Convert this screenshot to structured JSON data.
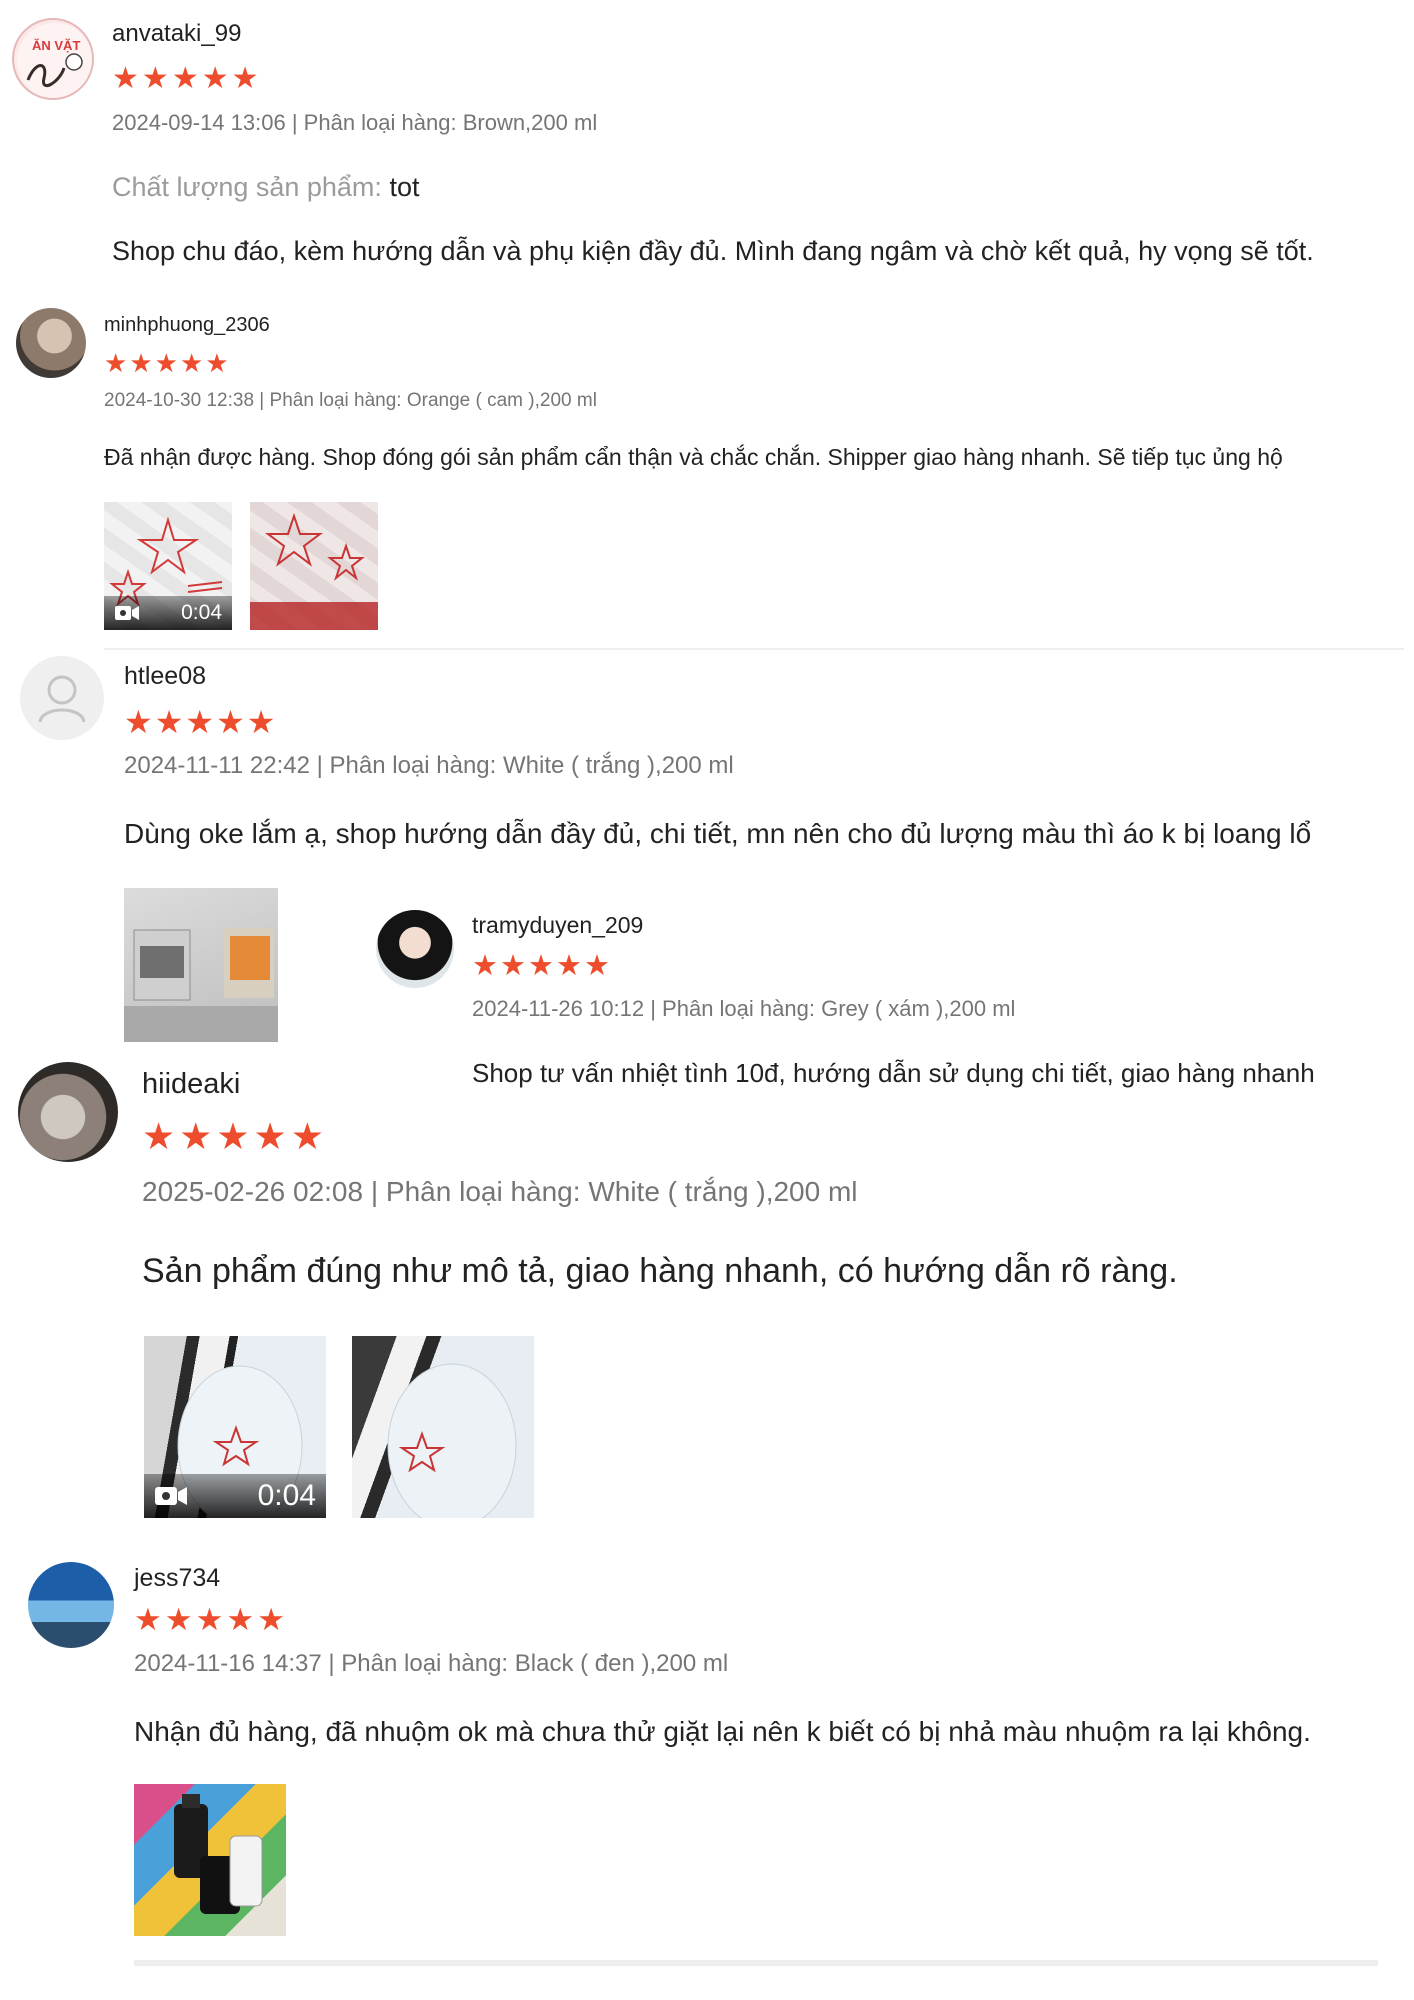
{
  "reviews": [
    {
      "username": "anvataki_99",
      "rating": 5,
      "date": "2024-09-14 13:06",
      "variation_label": "Phân loại hàng:",
      "variation": "Brown,200 ml",
      "separator": "|",
      "quality_label": "Chất lượng sản phẩm:",
      "quality_value": "tot",
      "comment": "Shop chu đáo, kèm hướng dẫn và phụ kiện đầy đủ. Mình đang ngâm và chờ kết quả, hy vọng sẽ tốt.",
      "avatar_text": "ĂN VẶT"
    },
    {
      "username": "minhphuong_2306",
      "rating": 5,
      "date": "2024-10-30 12:38",
      "variation_label": "Phân loại hàng:",
      "variation": "Orange ( cam ),200 ml",
      "separator": "|",
      "comment": "Đã nhận được hàng.  Shop đóng gói sản phẩm cẩn thận và chắc chắn.  Shipper giao hàng nhanh.  Sẽ tiếp tục ủng hộ",
      "media": [
        {
          "type": "video",
          "duration": "0:04"
        },
        {
          "type": "image"
        }
      ]
    },
    {
      "username": "htlee08",
      "rating": 5,
      "date": "2024-11-11 22:42",
      "variation_label": "Phân loại hàng:",
      "variation": "White ( trắng ),200 ml",
      "separator": "|",
      "comment": "Dùng oke lắm ạ, shop hướng dẫn đầy đủ, chi tiết, mn nên cho đủ lượng màu thì áo k bị loang lổ",
      "media": [
        {
          "type": "image"
        }
      ]
    },
    {
      "username": "tramyduyen_209",
      "rating": 5,
      "date": "2024-11-26 10:12",
      "variation_label": "Phân loại hàng:",
      "variation": "Grey ( xám ),200 ml",
      "separator": "|",
      "comment": "Shop tư vấn nhiệt tình 10đ, hướng dẫn sử dụng chi tiết, giao hàng nhanh"
    },
    {
      "username": "hiideaki",
      "rating": 5,
      "date": "2025-02-26 02:08",
      "variation_label": "Phân loại hàng:",
      "variation": "White ( trắng ),200 ml",
      "separator": "|",
      "comment": "Sản phẩm đúng như mô tả, giao hàng nhanh, có hướng dẫn rõ ràng.",
      "media": [
        {
          "type": "video",
          "duration": "0:04"
        },
        {
          "type": "image"
        }
      ]
    },
    {
      "username": "jess734",
      "rating": 5,
      "date": "2024-11-16 14:37",
      "variation_label": "Phân loại hàng:",
      "variation": "Black ( đen ),200 ml",
      "separator": "|",
      "comment": "Nhận đủ hàng, đã nhuộm ok mà chưa thử giặt lại nên k biết có bị nhả màu nhuộm ra lại không.",
      "media": [
        {
          "type": "image"
        }
      ]
    }
  ],
  "colors": {
    "star": "#ee4d2d",
    "meta": "#757575",
    "text": "#222222",
    "quality_label": "#9b9b9b"
  }
}
